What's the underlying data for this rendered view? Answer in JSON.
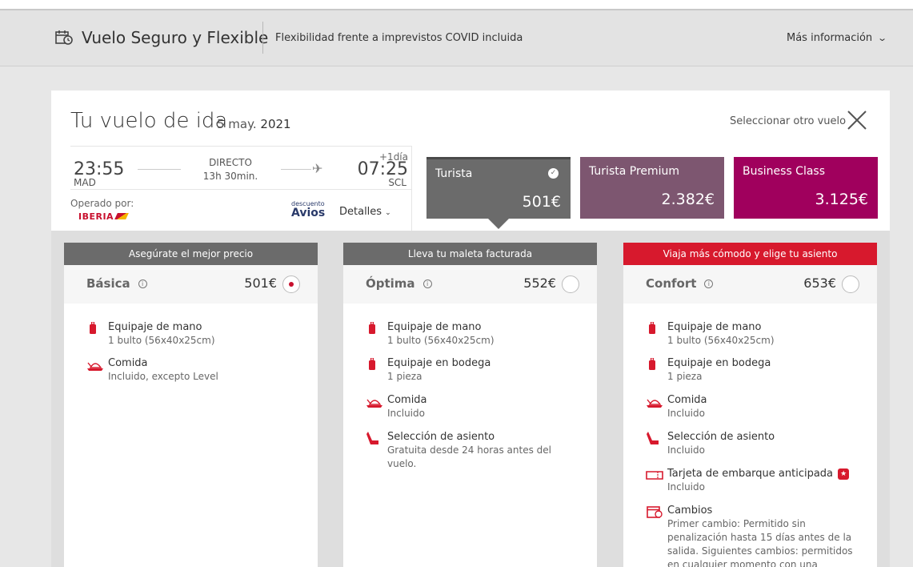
{
  "banner": {
    "title": "Vuelo Seguro y Flexible",
    "subtitle": "Flexibilidad frente a imprevistos COVID incluida",
    "more": "Más información"
  },
  "flight_header": {
    "title": "Tu vuelo de ida",
    "date": "5 may.",
    "year": "2021",
    "select_other": "Seleccionar otro vuelo"
  },
  "flight": {
    "departure_time": "23:55",
    "departure_code": "MAD",
    "type": "DIRECTO",
    "duration": "13h 30min.",
    "plus_day": "+1día",
    "arrival_time": "07:25",
    "arrival_code": "SCL",
    "operated_by": "Operado por:",
    "airline": "IBERIA",
    "avios_small": "descuento",
    "avios": "Avios",
    "details": "Detalles"
  },
  "cabins": [
    {
      "name": "Turista",
      "price": "501€",
      "color": "#6b6b6b",
      "selected": true
    },
    {
      "name": "Turista Premium",
      "price": "2.382€",
      "color": "#7d5670",
      "selected": false
    },
    {
      "name": "Business Class",
      "price": "3.125€",
      "color": "#a0005d",
      "selected": false
    }
  ],
  "fares": [
    {
      "band": "Asegúrate el mejor precio",
      "band_color": "#6b6b6b",
      "name": "Básica",
      "price": "501€",
      "selected": true,
      "features": [
        {
          "icon": "hand-luggage-icon",
          "title": "Equipaje de mano",
          "desc": "1 bulto (56x40x25cm)"
        },
        {
          "icon": "meal-icon",
          "title": "Comida",
          "desc": "Incluido, excepto Level"
        }
      ]
    },
    {
      "band": "Lleva tu maleta facturada",
      "band_color": "#6b6b6b",
      "name": "Óptima",
      "price": "552€",
      "selected": false,
      "features": [
        {
          "icon": "hand-luggage-icon",
          "title": "Equipaje de mano",
          "desc": "1 bulto (56x40x25cm)"
        },
        {
          "icon": "checked-luggage-icon",
          "title": "Equipaje en bodega",
          "desc": "1 pieza"
        },
        {
          "icon": "meal-icon",
          "title": "Comida",
          "desc": "Incluido"
        },
        {
          "icon": "seat-icon",
          "title": "Selección de asiento",
          "desc": "Gratuita desde 24 horas antes del vuelo."
        }
      ]
    },
    {
      "band": "Viaja más cómodo y elige tu asiento",
      "band_color": "#d7192d",
      "name": "Confort",
      "price": "653€",
      "selected": false,
      "features": [
        {
          "icon": "hand-luggage-icon",
          "title": "Equipaje de mano",
          "desc": "1 bulto (56x40x25cm)"
        },
        {
          "icon": "checked-luggage-icon",
          "title": "Equipaje en bodega",
          "desc": "1 pieza"
        },
        {
          "icon": "meal-icon",
          "title": "Comida",
          "desc": "Incluido"
        },
        {
          "icon": "seat-icon",
          "title": "Selección de asiento",
          "desc": "Incluido"
        },
        {
          "icon": "boarding-pass-icon",
          "title": "Tarjeta de embarque anticipada",
          "desc": "Incluido"
        },
        {
          "icon": "calendar-icon",
          "title": "Cambios",
          "desc": "Primer cambio: Permitido sin penalización hasta 15 días antes de la salida. Siguientes cambios: permitidos en cualquier momento con una"
        }
      ]
    }
  ]
}
